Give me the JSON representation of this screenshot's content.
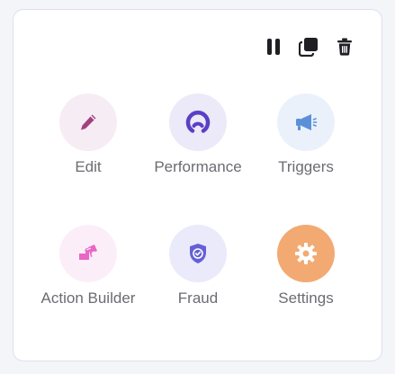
{
  "toolbar": {
    "pause_icon": "pause-icon",
    "duplicate_icon": "duplicate-icon",
    "delete_icon": "trash-icon"
  },
  "tiles": [
    {
      "label": "Edit",
      "icon": "pencil-icon",
      "bg": "#f5ecf4",
      "fg": "#a3407f"
    },
    {
      "label": "Performance",
      "icon": "gauge-icon",
      "bg": "#ece9f8",
      "fg": "#5b3fc4"
    },
    {
      "label": "Triggers",
      "icon": "megaphone-icon",
      "bg": "#ebf1fa",
      "fg": "#5b90d9"
    },
    {
      "label": "Action Builder",
      "icon": "puzzle-icon",
      "bg": "#fbeef9",
      "fg": "#e867c7"
    },
    {
      "label": "Fraud",
      "icon": "shield-check-icon",
      "bg": "#ebeafa",
      "fg": "#6461d6"
    },
    {
      "label": "Settings",
      "icon": "gear-icon",
      "bg": "#f2aa72",
      "fg": "#ffffff"
    }
  ]
}
